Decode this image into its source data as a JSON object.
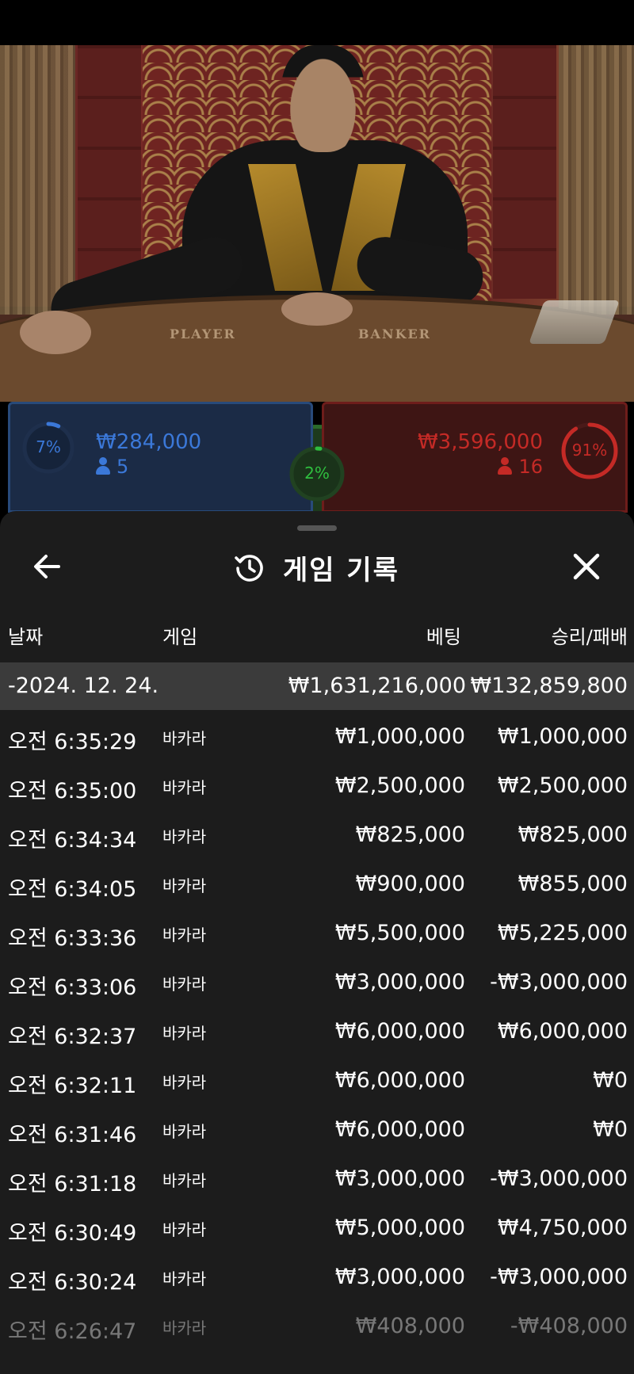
{
  "scene": {
    "player_label": "PLAYER",
    "banker_label": "BANKER"
  },
  "bets": {
    "player": {
      "percent": "7%",
      "percent_value": 7,
      "amount": "₩284,000",
      "count": "5",
      "color": "#3b78d8"
    },
    "tie": {
      "percent": "2%",
      "percent_value": 2,
      "color": "#2fbf3f"
    },
    "banker": {
      "percent": "91%",
      "percent_value": 91,
      "amount": "₩3,596,000",
      "count": "16",
      "color": "#c42a26"
    }
  },
  "sheet": {
    "title": "게임 기록",
    "back_icon": "arrow-left-icon",
    "close_icon": "close-icon",
    "title_icon": "history-icon",
    "columns": {
      "date": "날짜",
      "game": "게임",
      "bet": "베팅",
      "win_loss": "승리/패배"
    },
    "day": {
      "date": "-2024. 12. 24.",
      "bet": "₩1,631,216,000",
      "win_loss": "₩132,859,800"
    },
    "rows": [
      {
        "time": "오전 6:35:29",
        "game": "바카라",
        "bet": "₩1,000,000",
        "win_loss": "₩1,000,000"
      },
      {
        "time": "오전 6:35:00",
        "game": "바카라",
        "bet": "₩2,500,000",
        "win_loss": "₩2,500,000"
      },
      {
        "time": "오전 6:34:34",
        "game": "바카라",
        "bet": "₩825,000",
        "win_loss": "₩825,000"
      },
      {
        "time": "오전 6:34:05",
        "game": "바카라",
        "bet": "₩900,000",
        "win_loss": "₩855,000"
      },
      {
        "time": "오전 6:33:36",
        "game": "바카라",
        "bet": "₩5,500,000",
        "win_loss": "₩5,225,000"
      },
      {
        "time": "오전 6:33:06",
        "game": "바카라",
        "bet": "₩3,000,000",
        "win_loss": "-₩3,000,000"
      },
      {
        "time": "오전 6:32:37",
        "game": "바카라",
        "bet": "₩6,000,000",
        "win_loss": "₩6,000,000"
      },
      {
        "time": "오전 6:32:11",
        "game": "바카라",
        "bet": "₩6,000,000",
        "win_loss": "₩0"
      },
      {
        "time": "오전 6:31:46",
        "game": "바카라",
        "bet": "₩6,000,000",
        "win_loss": "₩0"
      },
      {
        "time": "오전 6:31:18",
        "game": "바카라",
        "bet": "₩3,000,000",
        "win_loss": "-₩3,000,000"
      },
      {
        "time": "오전 6:30:49",
        "game": "바카라",
        "bet": "₩5,000,000",
        "win_loss": "₩4,750,000"
      },
      {
        "time": "오전 6:30:24",
        "game": "바카라",
        "bet": "₩3,000,000",
        "win_loss": "-₩3,000,000"
      },
      {
        "time": "오전 6:26:47",
        "game": "바카라",
        "bet": "₩408,000",
        "win_loss": "-₩408,000"
      }
    ]
  }
}
